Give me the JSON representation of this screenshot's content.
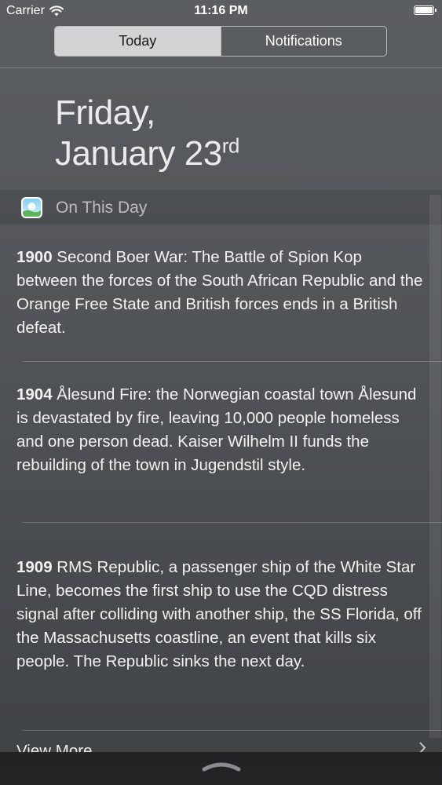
{
  "status_bar": {
    "carrier": "Carrier",
    "time": "11:16 PM",
    "icons": [
      "wifi-icon",
      "battery-icon"
    ],
    "battery_level": 1.0
  },
  "tabs": [
    {
      "label": "Today",
      "selected": true
    },
    {
      "label": "Notifications",
      "selected": false
    }
  ],
  "date": {
    "line1": "Friday,",
    "line2": "January 23",
    "suffix": "rd"
  },
  "widget": {
    "title": "On This Day",
    "icon": "on-this-day-app-icon",
    "entries": [
      {
        "year": "1900",
        "text": " Second Boer War: The Battle of Spion Kop between the forces of the South African Republic and the Orange Free State and British forces ends in a British defeat."
      },
      {
        "year": "1904",
        "text": " Ålesund Fire: the Norwegian coastal town Ålesund is devastated by fire, leaving 10,000 people homeless and one person dead. Kaiser Wilhelm II funds the rebuilding of the town in Jugendstil style."
      },
      {
        "year": "1909",
        "text": " RMS Republic, a passenger ship of the White Star Line, becomes the first ship to use the CQD distress signal after colliding with another ship, the SS Florida, off the Massachusetts coastline, an event that kills six people. The Republic sinks the next day."
      }
    ],
    "view_more": "View More"
  },
  "colors": {
    "background": "#505357",
    "segment_active": "#d2d3d5",
    "bottom_bar": "#232426"
  }
}
